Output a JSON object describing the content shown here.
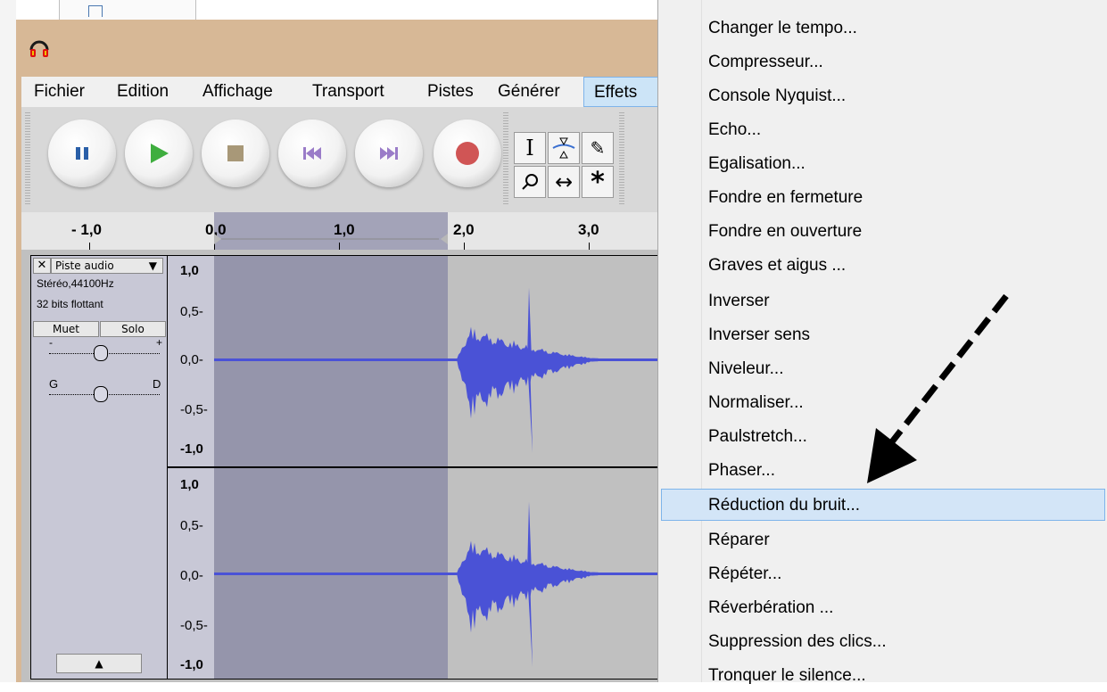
{
  "colors": {
    "window_bg": "#d7b896",
    "waveform": "#4a52d6",
    "selection": "#9595ab",
    "menu_highlight": "#d3e5f7"
  },
  "menubar": {
    "items": [
      "Fichier",
      "Edition",
      "Affichage",
      "Transport",
      "Pistes",
      "Générer",
      "Effets"
    ],
    "active": "Effets"
  },
  "toolbar": {
    "buttons": [
      "pause-icon",
      "play-icon",
      "stop-icon",
      "skip-start-icon",
      "skip-end-icon",
      "record-icon"
    ],
    "tools": [
      "selection-tool-icon",
      "envelope-tool-icon",
      "draw-tool-icon",
      "zoom-tool-icon",
      "timeshift-tool-icon",
      "multi-tool-icon"
    ]
  },
  "ruler": {
    "labels": [
      "- 1,0",
      "0,0",
      "1,0",
      "2,0",
      "3,0"
    ]
  },
  "track": {
    "name": "Piste audio",
    "format": "Stéréo,44100Hz",
    "bits": "32 bits flottant",
    "mute_label": "Muet",
    "solo_label": "Solo",
    "gain_minus": "-",
    "gain_plus": "+",
    "pan_left": "G",
    "pan_right": "D",
    "close_glyph": "✕",
    "collapse_glyph": "▲",
    "y_labels": [
      "1,0",
      "0,5-",
      "0,0-",
      "-0,5-",
      "-1,0"
    ]
  },
  "effects_menu": {
    "items": [
      "Changer le tempo...",
      "Compresseur...",
      "Console Nyquist...",
      "Echo...",
      "Egalisation...",
      "Fondre en fermeture",
      "Fondre en ouverture",
      "Graves et aigus ...",
      "Inverser",
      "Inverser sens",
      "Niveleur...",
      "Normaliser...",
      "Paulstretch...",
      "Phaser...",
      "Réduction du bruit...",
      "Réparer",
      "Répéter...",
      "Réverbération ...",
      "Suppression des clics...",
      "Tronquer le silence..."
    ],
    "highlighted": "Réduction du bruit..."
  }
}
